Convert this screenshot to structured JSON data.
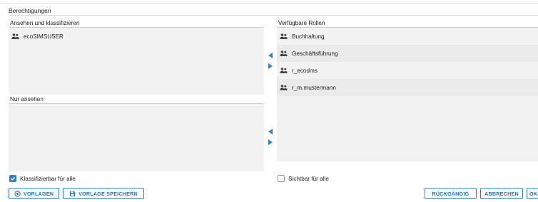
{
  "section": {
    "title": "Berechtigungen"
  },
  "left": {
    "classify_label": "Ansehen und klassifizieren",
    "classify_items": [
      {
        "label": "ecoSIMSUSER",
        "icon": "users-icon"
      }
    ],
    "view_label": "Nur ansehen",
    "view_items": []
  },
  "right": {
    "label": "Verfügbare Rollen",
    "items": [
      {
        "label": "Buchhaltung",
        "icon": "users-icon"
      },
      {
        "label": "Geschäftsführung",
        "icon": "users-icon"
      },
      {
        "label": "r_ecodms",
        "icon": "users-icon"
      },
      {
        "label": "r_m.mustermann",
        "icon": "users-icon"
      }
    ]
  },
  "checkboxes": {
    "classify_all": {
      "label": "Klassifizierbar für alle",
      "checked": true
    },
    "visible_all": {
      "label": "Sichtbar für alle",
      "checked": false
    }
  },
  "buttons": {
    "templates": "VORLAGEN",
    "save_template": "VORLAGE SPEICHERN",
    "undo": "RÜCKGÄNGIG",
    "cancel": "ABBRECHEN",
    "ok": "OK"
  },
  "colors": {
    "accent": "#2f83c9",
    "pane_bg": "#f2f2f2"
  }
}
